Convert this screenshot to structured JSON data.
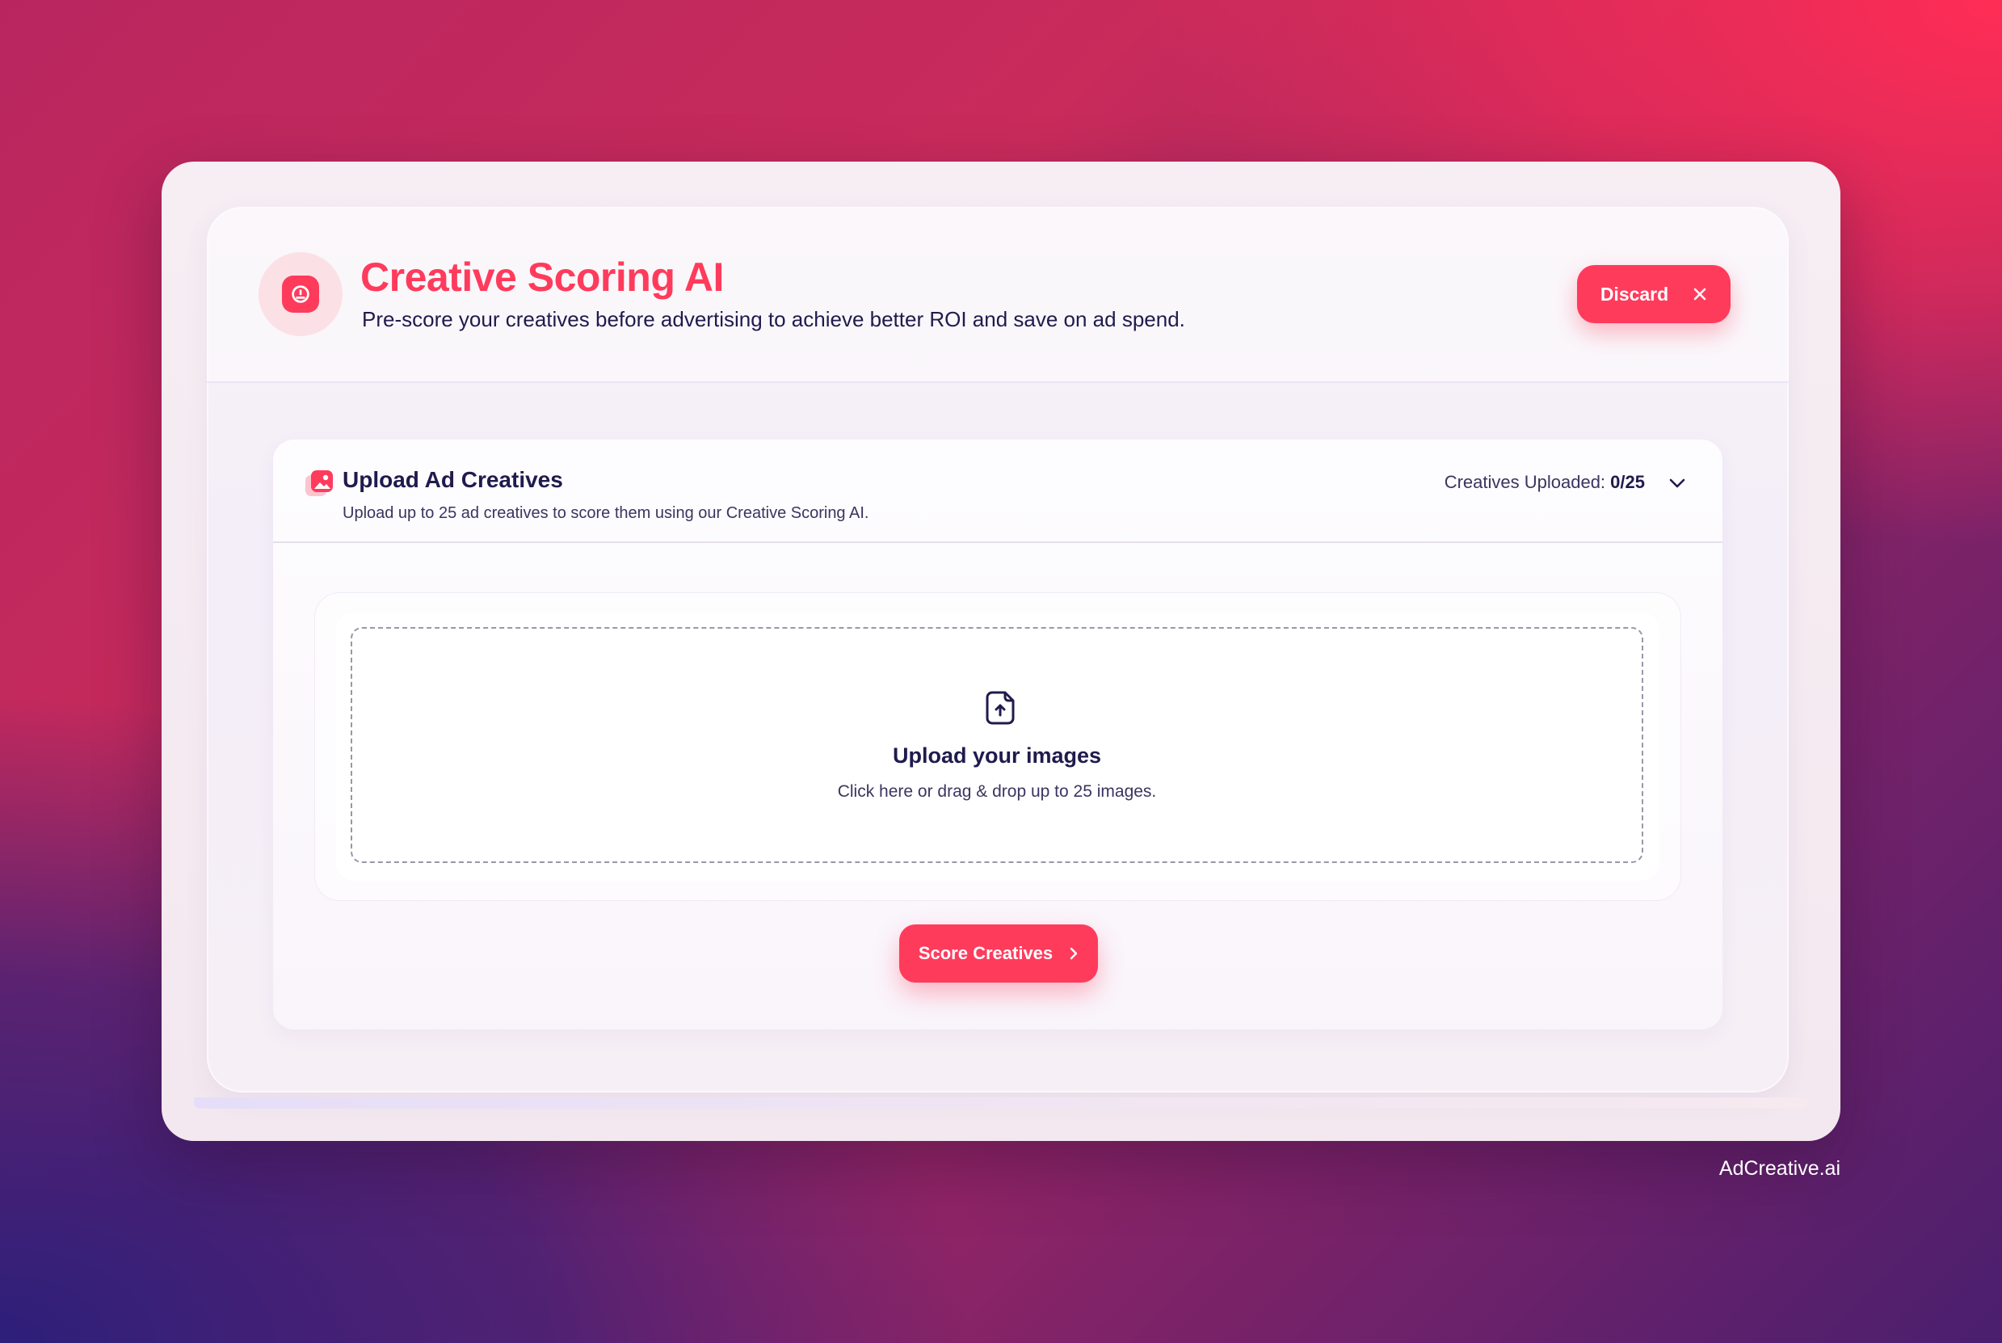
{
  "header": {
    "title": "Creative Scoring AI",
    "subtitle": "Pre-score your creatives before advertising to achieve better ROI and save on ad spend.",
    "icon": "gauge-icon",
    "discard_label": "Discard"
  },
  "upload": {
    "title": "Upload Ad Creatives",
    "subtitle": "Upload up to 25 ad creatives to score them using our Creative Scoring AI.",
    "counter_label": "Creatives Uploaded:",
    "counter_value": "0/25",
    "icon": "images-icon"
  },
  "dropzone": {
    "title": "Upload your images",
    "subtitle": "Click here or drag & drop up to 25 images.",
    "icon": "file-upload-icon"
  },
  "actions": {
    "score_label": "Score Creatives"
  },
  "brand": {
    "watermark": "AdCreative.ai"
  },
  "colors": {
    "accent": "#ff3b5c",
    "text_primary": "#1f1b4d",
    "accent_soft": "#fbe1e6"
  }
}
